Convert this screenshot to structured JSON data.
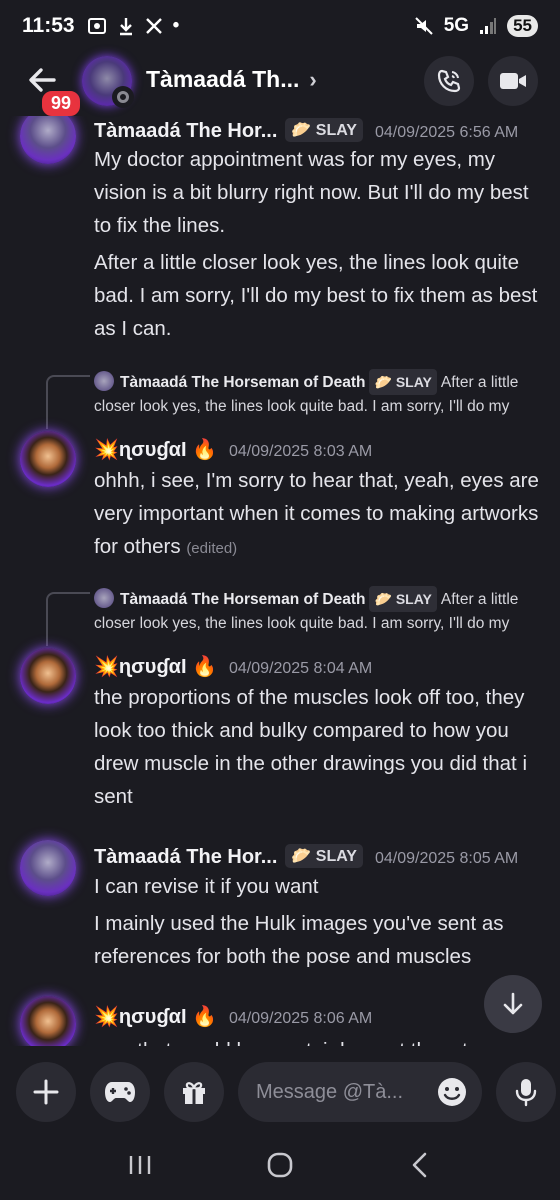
{
  "status_bar": {
    "time": "11:53",
    "network": "5G",
    "battery": "55"
  },
  "header": {
    "back_badge": "99",
    "title": "Tàmaadá Th...",
    "chevron": "›"
  },
  "messages": [
    {
      "author": "Tàmaadá The Hor...",
      "tag": "SLAY",
      "timestamp": "04/09/2025 6:56 AM",
      "paragraphs": [
        "My doctor appointment was for my eyes, my vision is a bit blurry right now. But I'll do my best to fix the lines.",
        "After a little closer look yes, the lines look quite bad. I am sorry, I'll do my best to fix them as best as I can."
      ]
    },
    {
      "reply": {
        "author": "Tàmaadá The Horseman of Death",
        "tag": "SLAY",
        "text": "After a little closer look yes, the lines look quite bad. I am sorry, I'll do my"
      },
      "author_prefix": "💥",
      "author": "ɳσυɠαƖ",
      "author_suffix": "🔥",
      "timestamp": "04/09/2025 8:03 AM",
      "text": "ohhh, i see, I'm sorry to hear that, yeah, eyes are very important when it comes to making artworks for others",
      "edited": "(edited)"
    },
    {
      "reply": {
        "author": "Tàmaadá The Horseman of Death",
        "tag": "SLAY",
        "text": "After a little closer look yes, the lines look quite bad. I am sorry, I'll do my"
      },
      "author_prefix": "💥",
      "author": "ɳσυɠαƖ",
      "author_suffix": "🔥",
      "timestamp": "04/09/2025 8:04 AM",
      "text": "the proportions of the muscles look off too, they look too thick and bulky compared to how you drew muscle in the other drawings you did that i sent"
    },
    {
      "author": "Tàmaadá The Hor...",
      "tag": "SLAY",
      "timestamp": "04/09/2025 8:05 AM",
      "paragraphs": [
        "I can revise it if you want",
        "I mainly used the Hulk images you've sent as references for both the pose and muscles"
      ]
    },
    {
      "author_prefix": "💥",
      "author": "ɳσυɠαƖ",
      "author_suffix": "🔥",
      "timestamp": "04/09/2025 8:06 AM",
      "text": "yes, that would be great, i do want them to"
    }
  ],
  "composer": {
    "placeholder": "Message @Tà..."
  },
  "colors": {
    "background": "#1b1b21",
    "badge": "#e8333e",
    "avatar_glow": "#8a4cf0"
  }
}
